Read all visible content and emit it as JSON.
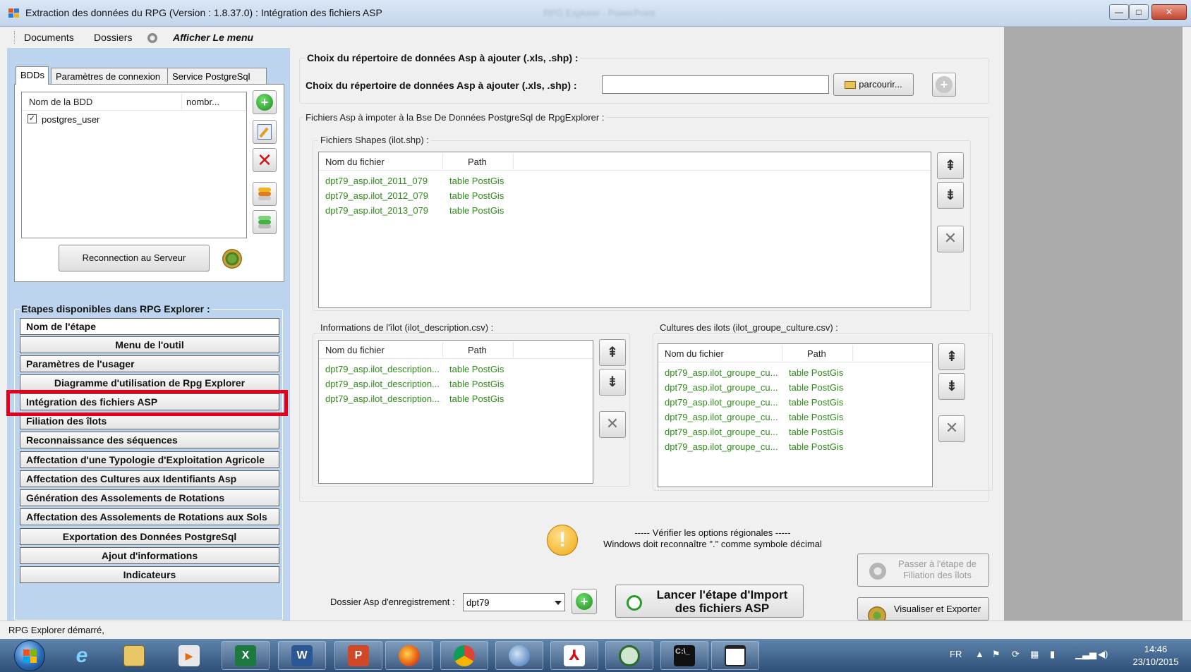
{
  "window": {
    "title": "Extraction des données du RPG (Version : 1.8.37.0) : Intégration des fichiers ASP",
    "ghost_title": "RPG Explorer - PowerPoint",
    "min": "—",
    "max": "□",
    "close": "✕"
  },
  "menu": {
    "documents": "Documents",
    "dossiers": "Dossiers",
    "afficher": "Afficher Le menu"
  },
  "db_tabs": {
    "tabs": [
      "BDDs",
      "Paramètres de connexion",
      "Service PostgreSql"
    ],
    "columns": [
      "Nom de la BDD",
      "nombr..."
    ],
    "rows": [
      {
        "checked": "✓",
        "name": "postgres_user"
      }
    ],
    "reconnect_button": "Reconnection au Serveur"
  },
  "steps": {
    "legend": "Etapes disponibles dans RPG Explorer :",
    "items": [
      "Nom de l'étape",
      "Menu de l'outil",
      "Paramètres de l'usager",
      "Diagramme d'utilisation de Rpg Explorer",
      "Intégration des fichiers ASP",
      "Filiation des îlots",
      "Reconnaissance des séquences",
      "Affectation d'une Typologie d'Exploitation Agricole",
      "Affectation des Cultures aux Identifiants Asp",
      "Génération des Assolements de Rotations",
      "Affectation des Assolements de Rotations aux Sols",
      "Exportation des Données PostgreSql",
      "Ajout d'informations",
      "Indicateurs"
    ],
    "selected": "Intégration des fichiers ASP"
  },
  "main": {
    "dir_group_title": "Choix du répertoire de données Asp à ajouter (.xls, .shp) :",
    "dir_label": "Choix du répertoire de données Asp à ajouter (.xls, .shp) :",
    "dir_value": "",
    "browse_button": "parcourir...",
    "import_group_title": "Fichiers Asp à impoter à la Bse De Données PostgreSql de RpgExplorer :",
    "shapes": {
      "title": "Fichiers Shapes (ilot.shp) :",
      "columns": [
        "Nom du fichier",
        "Path"
      ],
      "rows": [
        {
          "file": "dpt79_asp.ilot_2011_079",
          "path": "table PostGis"
        },
        {
          "file": "dpt79_asp.ilot_2012_079",
          "path": "table PostGis"
        },
        {
          "file": "dpt79_asp.ilot_2013_079",
          "path": "table PostGis"
        }
      ]
    },
    "descriptions": {
      "title": "Informations de l'îlot (ilot_description.csv) :",
      "columns": [
        "Nom du fichier",
        "Path"
      ],
      "rows": [
        {
          "file": "dpt79_asp.ilot_description...",
          "path": "table PostGis"
        },
        {
          "file": "dpt79_asp.ilot_description...",
          "path": "table PostGis"
        },
        {
          "file": "dpt79_asp.ilot_description...",
          "path": "table PostGis"
        }
      ]
    },
    "cultures": {
      "title": "Cultures des ilots (ilot_groupe_culture.csv) :",
      "columns": [
        "Nom du fichier",
        "Path"
      ],
      "rows": [
        {
          "file": "dpt79_asp.ilot_groupe_cu...",
          "path": "table PostGis"
        },
        {
          "file": "dpt79_asp.ilot_groupe_cu...",
          "path": "table PostGis"
        },
        {
          "file": "dpt79_asp.ilot_groupe_cu...",
          "path": "table PostGis"
        },
        {
          "file": "dpt79_asp.ilot_groupe_cu...",
          "path": "table PostGis"
        },
        {
          "file": "dpt79_asp.ilot_groupe_cu...",
          "path": "table PostGis"
        },
        {
          "file": "dpt79_asp.ilot_groupe_cu...",
          "path": "table PostGis"
        }
      ]
    },
    "note_line1": "----- Vérifier les options régionales -----",
    "note_line2": "Windows doit reconnaître \".\" comme symbole décimal",
    "save_dir_label": "Dossier Asp d'enregistrement :",
    "save_dir_value": "dpt79",
    "launch_line1": "Lancer l'étape d'Import",
    "launch_line2": "des fichiers ASP",
    "next_step_line1": "Passer à l'étape de",
    "next_step_line2": "Filiation des îlots",
    "export_line1": "Visualiser et Exporter"
  },
  "status": {
    "text": "RPG Explorer démarré,"
  },
  "taskbar": {
    "lang": "FR",
    "time": "14:46",
    "date": "23/10/2015",
    "apps": [
      "internet-explorer",
      "file-explorer",
      "media-player",
      "excel",
      "word",
      "powerpoint",
      "firefox",
      "chrome",
      "thunderbird",
      "acrobat",
      "qgis",
      "command-prompt",
      "window"
    ]
  },
  "colors": {
    "file_green": "#2e8b1a",
    "highlight_red": "#e3001b",
    "panel_blue": "#bcd4ee"
  }
}
